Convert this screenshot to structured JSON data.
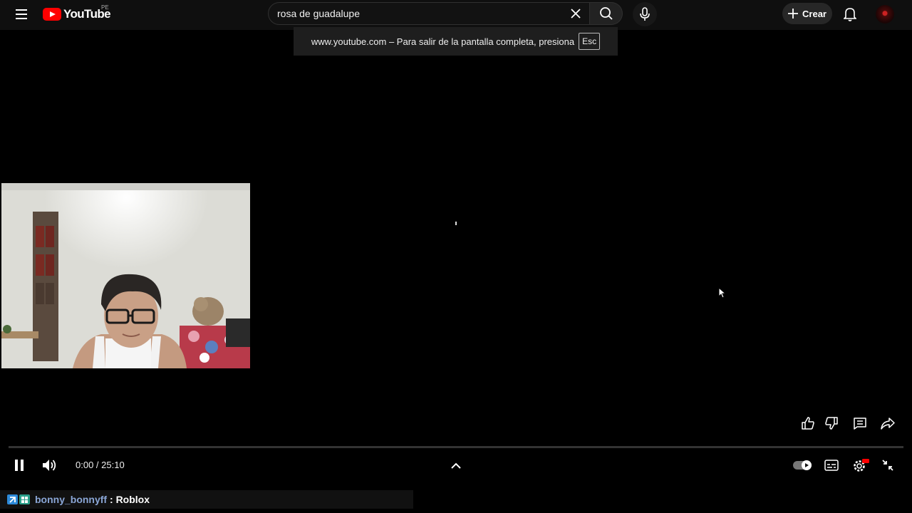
{
  "header": {
    "logo_text": "YouTube",
    "country_code": "PE",
    "search_value": "rosa de guadalupe",
    "create_label": "Crear"
  },
  "fullscreen_notice": {
    "text": "www.youtube.com – Para salir de la pantalla completa, presiona",
    "key": "Esc"
  },
  "player": {
    "current_time": "0:00",
    "separator": " / ",
    "duration": "25:10",
    "progress_fraction": 0
  },
  "chat": {
    "username": "bonny_bonnyff",
    "separator": " : ",
    "message": "Roblox"
  },
  "icons": {
    "menu": "menu-icon",
    "search": "search-icon",
    "clear": "close-icon",
    "mic": "microphone-icon",
    "create": "plus-icon",
    "notifications": "bell-icon",
    "like": "thumbs-up-icon",
    "dislike": "thumbs-down-icon",
    "comments": "comment-icon",
    "share": "share-icon",
    "pause": "pause-icon",
    "volume": "volume-icon",
    "chapters": "chevron-up-icon",
    "autoplay": "autoplay-toggle-icon",
    "captions": "subtitles-icon",
    "settings": "gear-icon",
    "exit_fullscreen": "exit-fullscreen-icon"
  },
  "colors": {
    "brand_red": "#ff0000",
    "masthead_bg": "#0f0f0f",
    "chat_username": "#8aa6d6"
  }
}
